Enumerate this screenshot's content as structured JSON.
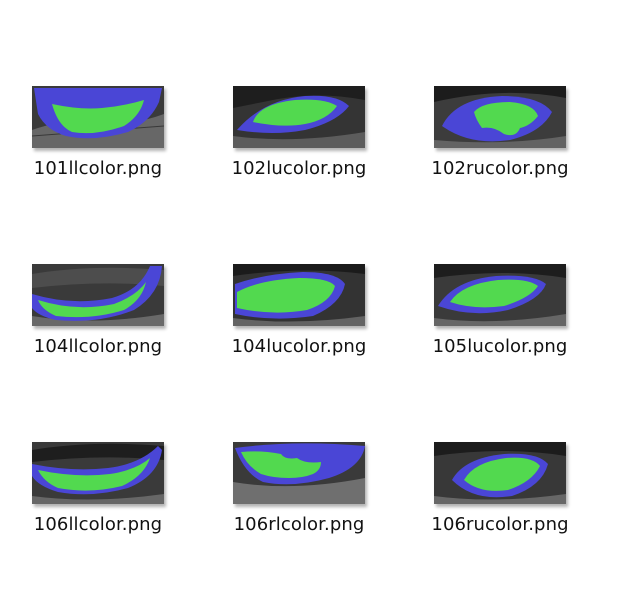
{
  "colors": {
    "background": "#ffffff",
    "mask_outer": "#4a46d6",
    "mask_inner": "#52d94f",
    "photo_dark": "#2f2f2f",
    "photo_light": "#9a9a9a"
  },
  "files": [
    {
      "name": "101llcolor.png",
      "thumbnail": "lower-lid-eye-mask"
    },
    {
      "name": "102lucolor.png",
      "thumbnail": "upper-lid-eye-mask"
    },
    {
      "name": "102rucolor.png",
      "thumbnail": "upper-lid-eye-mask"
    },
    {
      "name": "104llcolor.png",
      "thumbnail": "lower-lid-eye-mask"
    },
    {
      "name": "104lucolor.png",
      "thumbnail": "upper-lid-eye-mask"
    },
    {
      "name": "105lucolor.png",
      "thumbnail": "upper-lid-eye-mask"
    },
    {
      "name": "106llcolor.png",
      "thumbnail": "lower-lid-eye-mask"
    },
    {
      "name": "106rlcolor.png",
      "thumbnail": "lower-lid-eye-mask"
    },
    {
      "name": "106rucolor.png",
      "thumbnail": "upper-lid-eye-mask"
    }
  ]
}
